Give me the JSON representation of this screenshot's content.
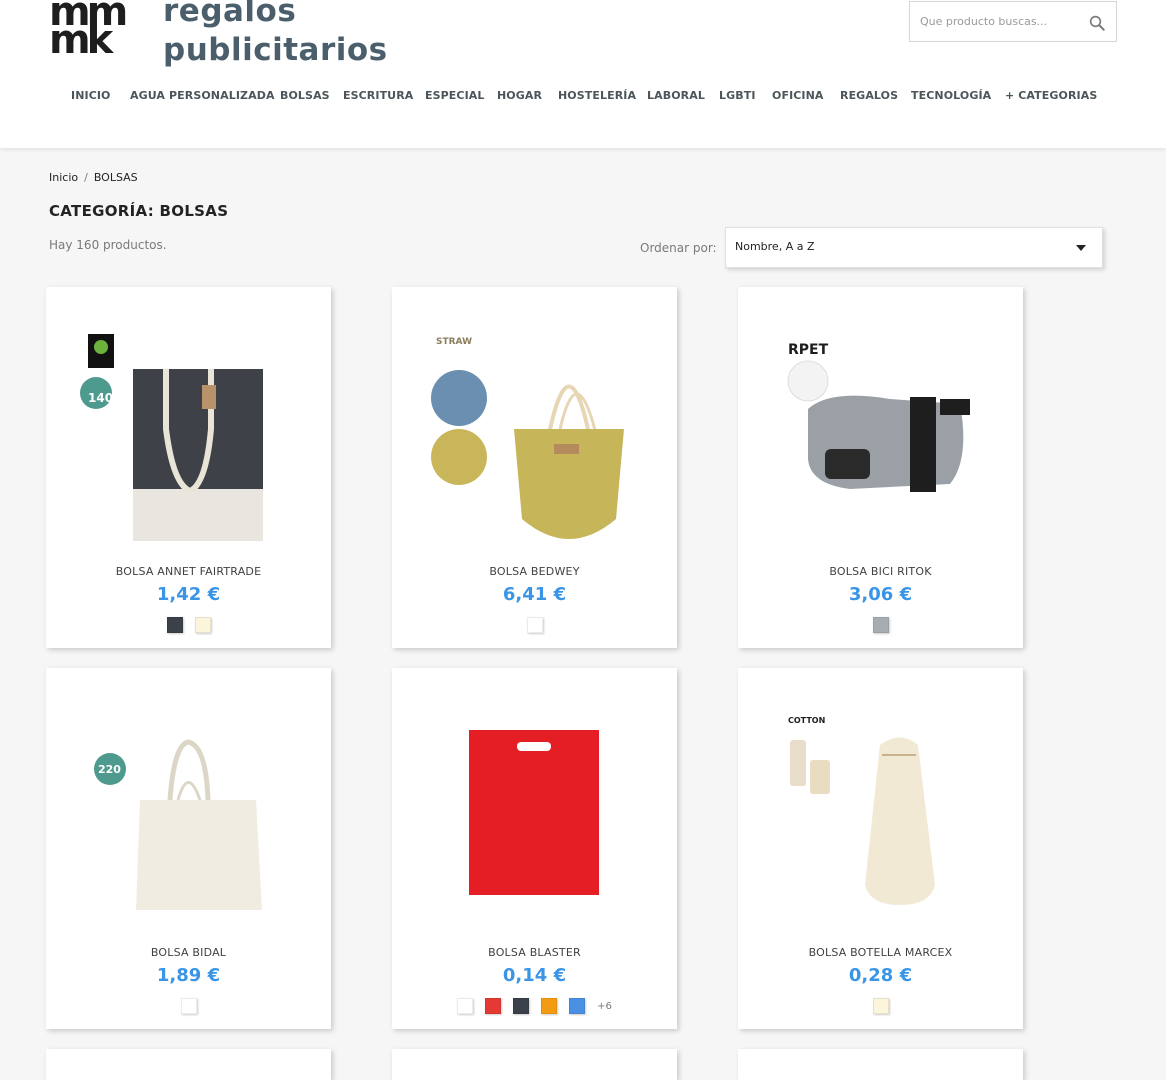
{
  "logo": {
    "mark_top": "mm",
    "mark_bottom": "mk",
    "line1": "regalos",
    "line2": "publicitarios"
  },
  "search": {
    "placeholder": "Que producto buscas..."
  },
  "nav": [
    "INICIO",
    "AGUA PERSONALIZADA",
    "BOLSAS",
    "ESCRITURA",
    "ESPECIAL",
    "HOGAR",
    "HOSTELERÍA",
    "LABORAL",
    "LGBTI",
    "OFICINA",
    "REGALOS",
    "TECNOLOGÍA",
    "+ CATEGORIAS"
  ],
  "breadcrumb": {
    "home": "Inicio",
    "separator": "/",
    "current": "BOLSAS"
  },
  "page_title": "CATEGORÍA: BOLSAS",
  "product_count": "Hay 160 productos.",
  "sort": {
    "label": "Ordenar por:",
    "value": "Nombre, A a Z"
  },
  "products": [
    {
      "name": "BOLSA ANNET FAIRTRADE",
      "price": "1,42 €",
      "swatches": [
        "#3b4148",
        "#fbf5dc"
      ],
      "more": "",
      "badge": "140",
      "label_tag": ""
    },
    {
      "name": "BOLSA BEDWEY",
      "price": "6,41 €",
      "swatches": [
        "#ffffff"
      ],
      "more": "",
      "badge": "",
      "label_tag": "STRAW"
    },
    {
      "name": "BOLSA BICI RITOK",
      "price": "3,06 €",
      "swatches": [
        "#a7aeb3"
      ],
      "more": "",
      "badge": "",
      "label_tag": "RPET"
    },
    {
      "name": "BOLSA BIDAL",
      "price": "1,89 €",
      "swatches": [
        "#ffffff"
      ],
      "more": "",
      "badge": "220",
      "label_tag": ""
    },
    {
      "name": "BOLSA BLASTER",
      "price": "0,14 €",
      "swatches": [
        "#ffffff",
        "#e53935",
        "#3b4148",
        "#f39c12",
        "#4a90e2"
      ],
      "more": "+6",
      "badge": "",
      "label_tag": ""
    },
    {
      "name": "BOLSA BOTELLA MARCEX",
      "price": "0,28 €",
      "swatches": [
        "#fbf5dc"
      ],
      "more": "",
      "badge": "",
      "label_tag": "COTTON"
    }
  ]
}
